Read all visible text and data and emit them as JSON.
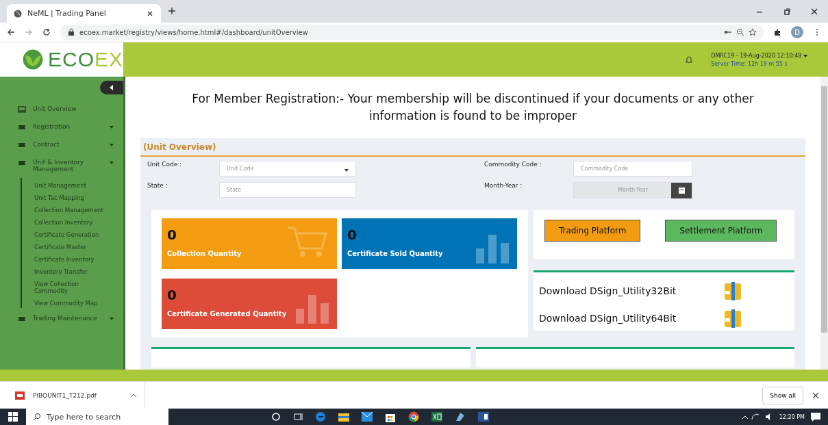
{
  "browser": {
    "tab_title": "NeML | Trading Panel",
    "url": "ecoex.market/registry/views/home.html#/dashboard/unitOverview",
    "profile_initial": "D"
  },
  "header": {
    "logo_parts": [
      "ECO",
      "EX"
    ],
    "user_line": "DMRC19 - 19-Aug-2020 12:10:48",
    "server_time": "Server Time: 12h 19 m 55 s"
  },
  "sidebar": {
    "expanded": true,
    "items": [
      {
        "label": "Unit Overview",
        "kind": "link"
      },
      {
        "label": "Registration",
        "kind": "group"
      },
      {
        "label": "Contract",
        "kind": "group"
      },
      {
        "label": "Unit & Inventory Management",
        "kind": "group",
        "children": [
          {
            "label": "Unit Management"
          },
          {
            "label": "Unit Tac Mapping"
          },
          {
            "label": "Collection Management"
          },
          {
            "label": "Collection Inventory"
          },
          {
            "label": "Certificate Generation"
          },
          {
            "label": "Certificate Master"
          },
          {
            "label": "Certificate Inventory"
          },
          {
            "label": "Inventory Transfer"
          },
          {
            "label": "View Collection Commodity"
          },
          {
            "label": "View Commodity Map"
          }
        ]
      },
      {
        "label": "Trading Maintenance",
        "kind": "group"
      }
    ]
  },
  "notice": "For Member Registration:- Your membership will be discontinued if your documents or any other information is found to be improper",
  "panel": {
    "title": "(Unit Overview)",
    "fields": [
      {
        "label": "Unit Code :",
        "placeholder": "Unit Code",
        "kind": "select"
      },
      {
        "label": "Commodity Code :",
        "placeholder": "Commodity Code",
        "kind": "text"
      },
      {
        "label": "State :",
        "placeholder": "State",
        "kind": "text"
      },
      {
        "label": "Month-Year :",
        "placeholder": "Month-Year",
        "kind": "date"
      }
    ],
    "tiles": [
      {
        "value": "0",
        "label": "Collection Quantity",
        "color": "#f39c12",
        "kind": "cart"
      },
      {
        "value": "0",
        "label": "Certificate Sold Quantity",
        "color": "#0073b7",
        "kind": "bars"
      },
      {
        "value": "0",
        "label": "Certificate Generated Quantity",
        "color": "#dd4b39",
        "kind": "bars"
      }
    ],
    "platform_buttons": [
      {
        "label": "Trading Platform",
        "color": "#f39c12"
      },
      {
        "label": "Settlement Platform",
        "color": "#5cb85c"
      }
    ],
    "downloads": [
      "Download DSign_Utility32Bit",
      "Download DSign_Utility64Bit"
    ]
  },
  "download_bar": {
    "file": "PIBOUNIT1_T212.pdf",
    "show_all": "Show all"
  },
  "taskbar": {
    "search_placeholder": "Type here to search",
    "time": "12:20 PM"
  }
}
